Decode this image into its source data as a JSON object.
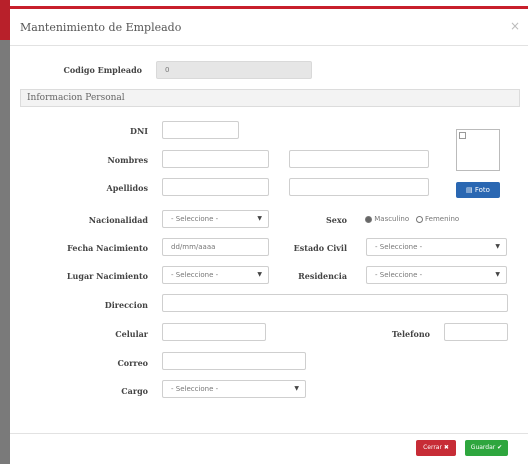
{
  "modal": {
    "title": "Mantenimiento de Empleado",
    "close": "×"
  },
  "codigo": {
    "label": "Codigo Empleado",
    "value": "0"
  },
  "section": {
    "title": "Informacion Personal"
  },
  "fields": {
    "dni": {
      "label": "DNI",
      "value": ""
    },
    "nombres": {
      "label": "Nombres",
      "value1": "",
      "value2": ""
    },
    "apellidos": {
      "label": "Apellidos",
      "value1": "",
      "value2": ""
    },
    "nacionalidad": {
      "label": "Nacionalidad",
      "selected": "- Seleccione -"
    },
    "sexo": {
      "label": "Sexo",
      "options": [
        "Masculino",
        "Femenino"
      ],
      "selected_index": 0
    },
    "fecha_nacimiento": {
      "label": "Fecha Nacimiento",
      "placeholder": "dd/mm/aaaa"
    },
    "estado_civil": {
      "label": "Estado Civil",
      "selected": "- Seleccione -"
    },
    "lugar_nacimiento": {
      "label": "Lugar Nacimiento",
      "selected": "- Seleccione -"
    },
    "residencia": {
      "label": "Residencia",
      "selected": "- Seleccione -"
    },
    "direccion": {
      "label": "Direccion",
      "value": ""
    },
    "celular": {
      "label": "Celular",
      "value": ""
    },
    "telefono": {
      "label": "Telefono",
      "value": ""
    },
    "correo": {
      "label": "Correo",
      "value": ""
    },
    "cargo": {
      "label": "Cargo",
      "selected": "- Seleccione -"
    }
  },
  "photo": {
    "button_label": "Foto",
    "icon": "folder-open-icon"
  },
  "footer": {
    "cancel_label": "Cerrar",
    "cancel_icon": "close-circle-icon",
    "save_label": "Guardar",
    "save_icon": "check-circle-icon"
  },
  "colors": {
    "accent": "#c81f2b",
    "primary": "#2a67b2",
    "danger": "#c72c36",
    "success": "#2ea63e"
  }
}
